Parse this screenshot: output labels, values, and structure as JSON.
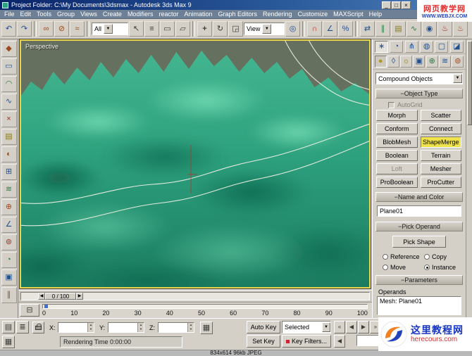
{
  "colors": {
    "active_button": "#f0e24a",
    "viewport_border": "#e8d44d",
    "terrain_base": "#2a9a79",
    "titlebar": "#0a246a"
  },
  "window": {
    "title": "Project Folder: C:\\My Documents\\3dsmax - Autodesk 3ds Max 9",
    "minimize": "_",
    "maximize": "□",
    "close": "×"
  },
  "menu": {
    "items": [
      "File",
      "Edit",
      "Tools",
      "Group",
      "Views",
      "Create",
      "Modifiers",
      "reactor",
      "Animation",
      "Graph Editors",
      "Rendering",
      "Customize",
      "MAXScript",
      "Help"
    ]
  },
  "toolbar": {
    "selection_filter": "All",
    "ref_coord": "View"
  },
  "viewport": {
    "label": "Perspective"
  },
  "command_panel": {
    "category_dropdown": "Compound Objects",
    "object_type": {
      "title": "Object Type",
      "autogrid_label": "AutoGrid",
      "buttons": [
        "Morph",
        "Scatter",
        "Conform",
        "Connect",
        "BlobMesh",
        "ShapeMerge",
        "Boolean",
        "Terrain",
        "Loft",
        "Mesher",
        "ProBoolean",
        "ProCutter"
      ]
    },
    "name_and_color": {
      "title": "Name and Color",
      "object_name": "Plane01"
    },
    "pick_operand": {
      "title": "Pick Operand",
      "pick_shape_label": "Pick Shape",
      "radio_reference": "Reference",
      "radio_copy": "Copy",
      "radio_move": "Move",
      "radio_instance": "Instance"
    },
    "parameters": {
      "title": "Parameters",
      "operands_label": "Operands",
      "operand_items": [
        "Mesh: Plane01"
      ]
    }
  },
  "timeline": {
    "slider_label": "0 / 100",
    "ticks": [
      "0",
      "10",
      "20",
      "30",
      "40",
      "50",
      "60",
      "70",
      "80",
      "90",
      "100"
    ]
  },
  "status_bar": {
    "x_label": "X:",
    "y_label": "Y:",
    "z_label": "Z:",
    "auto_key": "Auto Key",
    "set_key": "Set Key",
    "selected_filter": "Selected",
    "key_filters": "Key Filters...",
    "prompt": "Rendering Time 0:00:00"
  },
  "image_caption": "834x614 96kb JPEG",
  "watermarks": {
    "top": {
      "line1": "网页教学网",
      "line2": "WWW.WEBJX.COM"
    },
    "bottom": {
      "line1": "这里教程网",
      "line2": "herecours.com"
    }
  }
}
